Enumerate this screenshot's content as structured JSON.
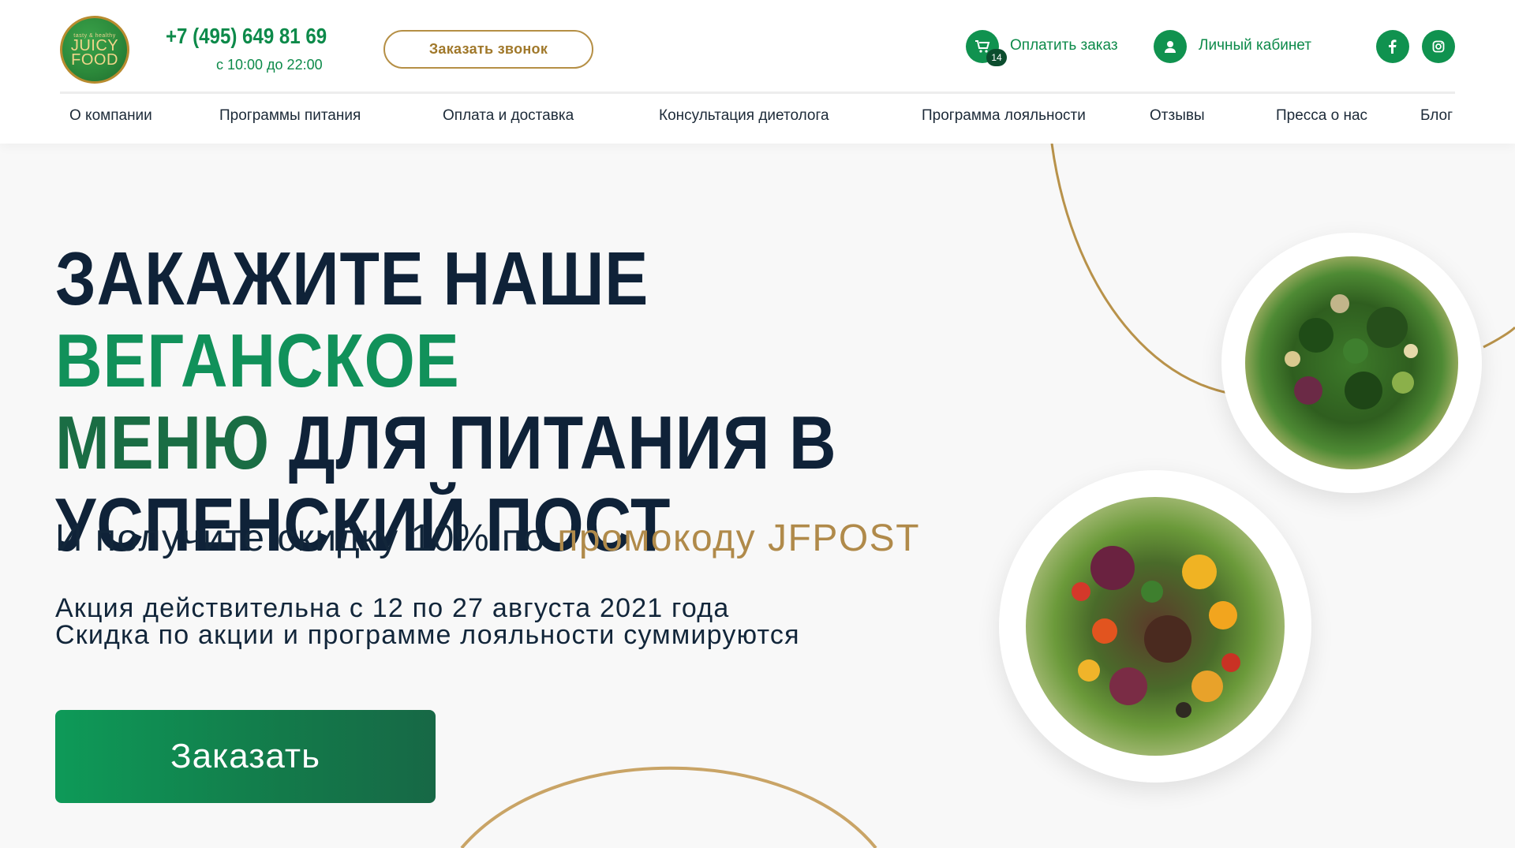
{
  "header": {
    "logo_text": [
      "tasty & healthy",
      "JUICY",
      "FOOD"
    ],
    "phone": "+7 (495) 649 81 69",
    "hours": "с 10:00 до 22:00",
    "callback_label": "Заказать звонок",
    "pay_label": "Оплатить заказ",
    "cart_count": "14",
    "cabinet_label": "Личный кабинет"
  },
  "nav": {
    "items": [
      "О компании",
      "Программы питания",
      "Оплата и доставка",
      "Консультация диетолога",
      "Программа лояльности",
      "Отзывы",
      "Пресса о нас",
      "Блог"
    ]
  },
  "hero": {
    "title_1": "ЗАКАЖИТЕ НАШЕ ",
    "title_green_1": "ВЕГАНСКОЕ",
    "title_green_2": "МЕНЮ",
    "title_2": " ДЛЯ ПИТАНИЯ В",
    "title_3": "УСПЕНСКИЙ ПОСТ",
    "subtitle_prefix": "И получите скидку 10% по ",
    "subtitle_promo": "промокоду JFPOST",
    "note_line_1": "Акция действительна с 12 по 27 августа 2021 года",
    "note_line_2": "Скидка по акции и программе лояльности суммируются",
    "order_label": "Заказать"
  },
  "colors": {
    "brand_green": "#10924f",
    "dark_navy": "#0f2238",
    "gold": "#b08a4a"
  }
}
